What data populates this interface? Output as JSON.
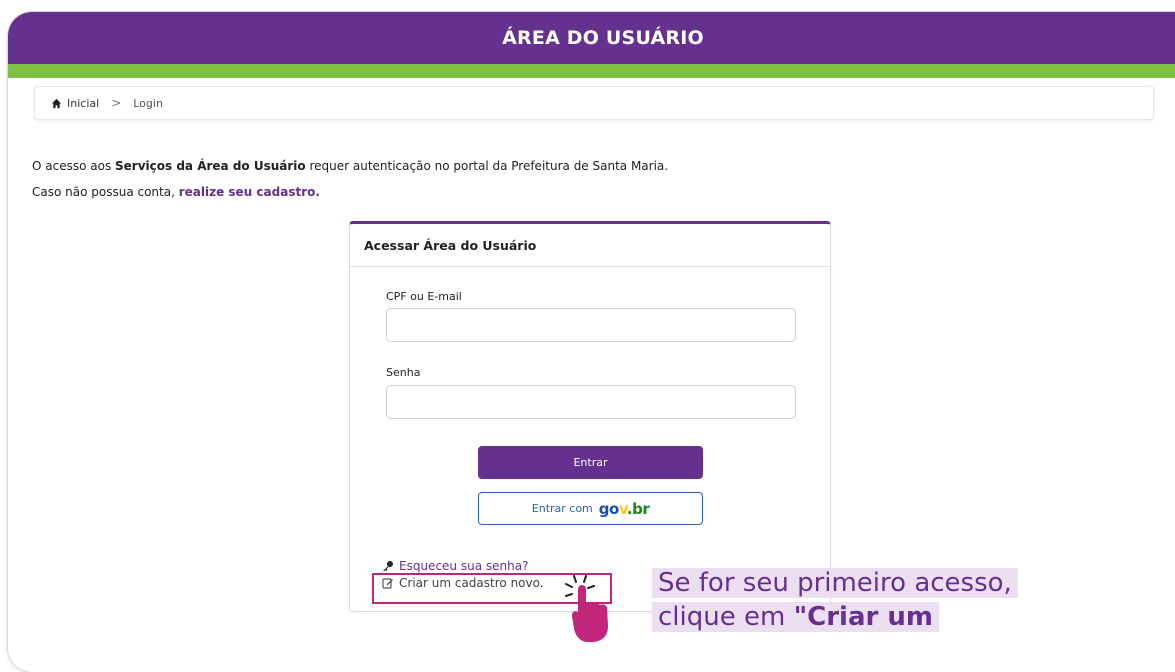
{
  "header": {
    "title": "ÁREA DO USUÁRIO"
  },
  "breadcrumb": {
    "home": "Inicial",
    "separator": ">",
    "current": "Login"
  },
  "intro": {
    "line1_pre": "O acesso aos ",
    "line1_bold": "Serviços da Área do Usuário",
    "line1_post": " requer autenticação no portal da Prefeitura de Santa Maria.",
    "line2_pre": "Caso não possua conta, ",
    "line2_link": "realize seu cadastro."
  },
  "login_card": {
    "title": "Acessar Área do Usuário",
    "cpf_label": "CPF ou E-mail",
    "cpf_value": "",
    "password_label": "Senha",
    "password_value": "",
    "submit_label": "Entrar",
    "gov_label": "Entrar com",
    "gov_logo": "gov.br",
    "forgot_link": "Esqueceu sua senha?",
    "create_link": "Criar um cadastro novo."
  },
  "callout": {
    "line1": "Se for seu primeiro acesso,",
    "line2_pre": "clique em ",
    "line2_bold": "\"Criar um"
  },
  "colors": {
    "primary": "#66308f",
    "green": "#7dc242",
    "highlight": "#c0267a"
  },
  "icons": [
    "home-icon",
    "key-icon",
    "edit-icon",
    "pointer-hand-icon"
  ]
}
